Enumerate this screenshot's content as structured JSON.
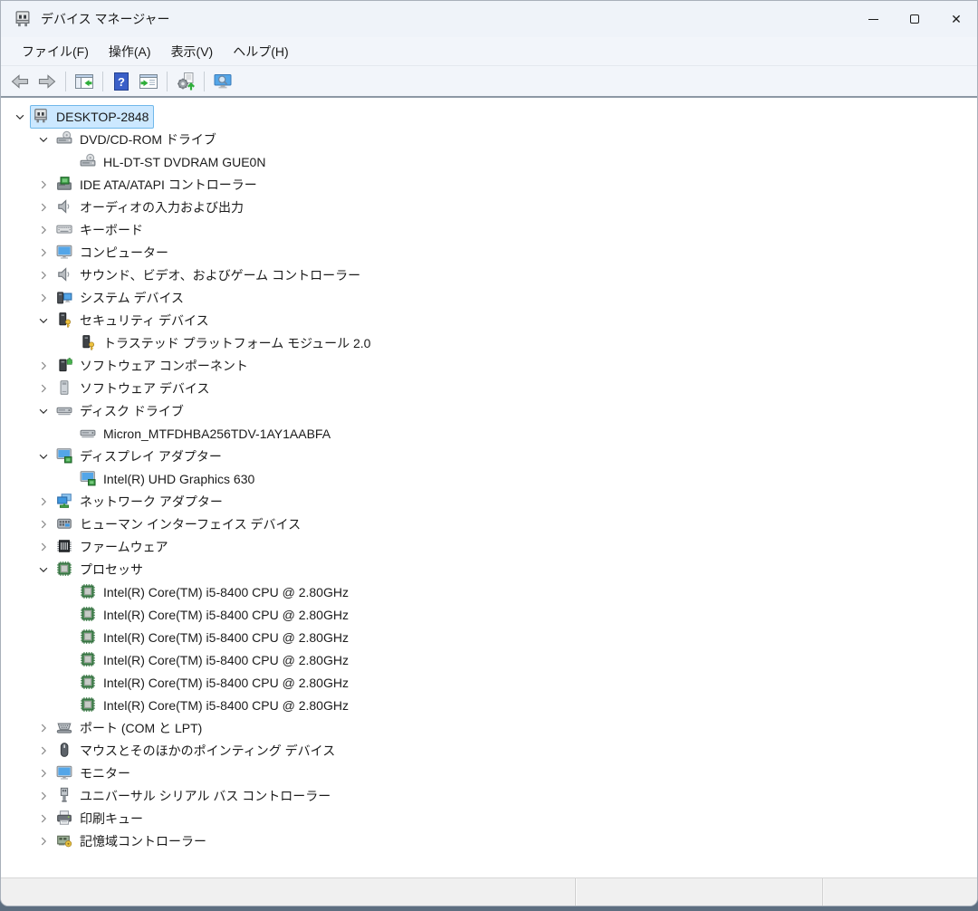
{
  "window": {
    "title": "デバイス マネージャー",
    "controls": [
      {
        "key": "minimize",
        "name": "minimize-button"
      },
      {
        "key": "maximize",
        "name": "maximize-button"
      },
      {
        "key": "close",
        "name": "close-button"
      }
    ]
  },
  "menu": {
    "items": [
      {
        "key": "file",
        "label": "ファイル(F)"
      },
      {
        "key": "action",
        "label": "操作(A)"
      },
      {
        "key": "view",
        "label": "表示(V)"
      },
      {
        "key": "help",
        "label": "ヘルプ(H)"
      }
    ]
  },
  "toolbar": {
    "items": [
      {
        "type": "button",
        "key": "back",
        "icon": "back-arrow-icon"
      },
      {
        "type": "button",
        "key": "forward",
        "icon": "forward-arrow-icon"
      },
      {
        "type": "separator"
      },
      {
        "type": "button",
        "key": "show-console-tree",
        "icon": "console-tree-icon"
      },
      {
        "type": "separator"
      },
      {
        "type": "button",
        "key": "help",
        "icon": "help-icon"
      },
      {
        "type": "button",
        "key": "properties",
        "icon": "properties-icon"
      },
      {
        "type": "separator"
      },
      {
        "type": "button",
        "key": "scan-hardware-changes",
        "icon": "scan-hardware-icon"
      },
      {
        "type": "separator"
      },
      {
        "type": "button",
        "key": "computer-scan",
        "icon": "monitor-search-icon"
      }
    ]
  },
  "tree": {
    "nodes": [
      {
        "label": "DESKTOP-2848",
        "level": 0,
        "state": "expanded",
        "icon": "computer-root",
        "selected": true
      },
      {
        "label": "DVD/CD-ROM ドライブ",
        "level": 1,
        "state": "expanded",
        "icon": "dvd-drive"
      },
      {
        "label": "HL-DT-ST DVDRAM GUE0N",
        "level": 2,
        "state": "leaf",
        "icon": "dvd-drive"
      },
      {
        "label": "IDE ATA/ATAPI コントローラー",
        "level": 1,
        "state": "collapsed",
        "icon": "ide-controller"
      },
      {
        "label": "オーディオの入力および出力",
        "level": 1,
        "state": "collapsed",
        "icon": "speaker"
      },
      {
        "label": "キーボード",
        "level": 1,
        "state": "collapsed",
        "icon": "keyboard"
      },
      {
        "label": "コンピューター",
        "level": 1,
        "state": "collapsed",
        "icon": "monitor"
      },
      {
        "label": "サウンド、ビデオ、およびゲーム コントローラー",
        "level": 1,
        "state": "collapsed",
        "icon": "speaker"
      },
      {
        "label": "システム デバイス",
        "level": 1,
        "state": "collapsed",
        "icon": "system-device"
      },
      {
        "label": "セキュリティ デバイス",
        "level": 1,
        "state": "expanded",
        "icon": "security-device"
      },
      {
        "label": "トラステッド プラットフォーム モジュール 2.0",
        "level": 2,
        "state": "leaf",
        "icon": "security-device"
      },
      {
        "label": "ソフトウェア コンポーネント",
        "level": 1,
        "state": "collapsed",
        "icon": "software-component"
      },
      {
        "label": "ソフトウェア デバイス",
        "level": 1,
        "state": "collapsed",
        "icon": "software-device"
      },
      {
        "label": "ディスク ドライブ",
        "level": 1,
        "state": "expanded",
        "icon": "disk-drive"
      },
      {
        "label": "Micron_MTFDHBA256TDV-1AY1AABFA",
        "level": 2,
        "state": "leaf",
        "icon": "disk-drive"
      },
      {
        "label": "ディスプレイ アダプター",
        "level": 1,
        "state": "expanded",
        "icon": "display-adapter"
      },
      {
        "label": "Intel(R) UHD Graphics 630",
        "level": 2,
        "state": "leaf",
        "icon": "display-adapter"
      },
      {
        "label": "ネットワーク アダプター",
        "level": 1,
        "state": "collapsed",
        "icon": "network-adapter"
      },
      {
        "label": "ヒューマン インターフェイス デバイス",
        "level": 1,
        "state": "collapsed",
        "icon": "hid-device"
      },
      {
        "label": "ファームウェア",
        "level": 1,
        "state": "collapsed",
        "icon": "firmware"
      },
      {
        "label": "プロセッサ",
        "level": 1,
        "state": "expanded",
        "icon": "processor"
      },
      {
        "label": "Intel(R) Core(TM) i5-8400 CPU @ 2.80GHz",
        "level": 2,
        "state": "leaf",
        "icon": "processor"
      },
      {
        "label": "Intel(R) Core(TM) i5-8400 CPU @ 2.80GHz",
        "level": 2,
        "state": "leaf",
        "icon": "processor"
      },
      {
        "label": "Intel(R) Core(TM) i5-8400 CPU @ 2.80GHz",
        "level": 2,
        "state": "leaf",
        "icon": "processor"
      },
      {
        "label": "Intel(R) Core(TM) i5-8400 CPU @ 2.80GHz",
        "level": 2,
        "state": "leaf",
        "icon": "processor"
      },
      {
        "label": "Intel(R) Core(TM) i5-8400 CPU @ 2.80GHz",
        "level": 2,
        "state": "leaf",
        "icon": "processor"
      },
      {
        "label": "Intel(R) Core(TM) i5-8400 CPU @ 2.80GHz",
        "level": 2,
        "state": "leaf",
        "icon": "processor"
      },
      {
        "label": "ポート (COM と LPT)",
        "level": 1,
        "state": "collapsed",
        "icon": "serial-port"
      },
      {
        "label": "マウスとそのほかのポインティング デバイス",
        "level": 1,
        "state": "collapsed",
        "icon": "mouse"
      },
      {
        "label": "モニター",
        "level": 1,
        "state": "collapsed",
        "icon": "monitor"
      },
      {
        "label": "ユニバーサル シリアル バス コントローラー",
        "level": 1,
        "state": "collapsed",
        "icon": "usb"
      },
      {
        "label": "印刷キュー",
        "level": 1,
        "state": "collapsed",
        "icon": "printer"
      },
      {
        "label": "記憶域コントローラー",
        "level": 1,
        "state": "collapsed",
        "icon": "storage-controller"
      }
    ]
  },
  "statusbar": {
    "sections": [
      "",
      "",
      ""
    ]
  },
  "colors": {
    "selection_bg": "#cce8ff",
    "selection_border": "#70b8ea",
    "chrome_bg": "#f2f5fa",
    "accent_blue": "#54a6e8",
    "accent_green": "#3c9e46"
  }
}
